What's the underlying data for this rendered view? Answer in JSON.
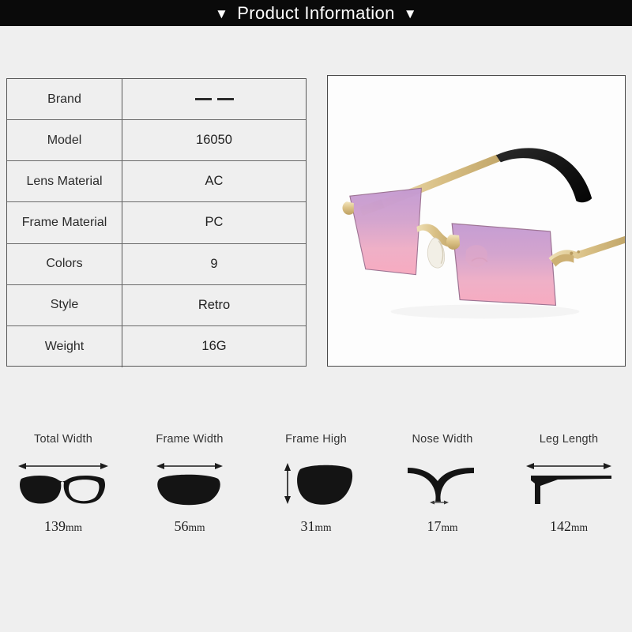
{
  "header": {
    "title": "Product Information",
    "left_marker": "▼",
    "right_marker": "▼",
    "background_color": "#0a0a0a",
    "text_color": "#ffffff"
  },
  "spec_table": {
    "rows": [
      {
        "label": "Brand",
        "value": "— —",
        "is_dash": true
      },
      {
        "label": "Model",
        "value": "16050",
        "is_dash": false
      },
      {
        "label": "Lens Material",
        "value": "AC",
        "is_dash": false
      },
      {
        "label": "Frame Material",
        "value": "PC",
        "is_dash": false
      },
      {
        "label": "Colors",
        "value": "9",
        "is_dash": false
      },
      {
        "label": "Style",
        "value": "Retro",
        "is_dash": false
      },
      {
        "label": "Weight",
        "value": "16G",
        "is_dash": false
      }
    ]
  },
  "product_image": {
    "alt": "Rimless rectangular sunglasses with gold metal temples, black temple tips and purple-to-pink gradient lenses",
    "lens_gradient_top": "#c9a0d6",
    "lens_gradient_bottom": "#f5a7c3",
    "metal_color": "#e8d49a",
    "temple_tip_color": "#141414",
    "background_color": "#fdfdfd"
  },
  "measurements": [
    {
      "label": "Total Width",
      "number": "139",
      "unit": "mm",
      "icon": "full-frame-width-icon"
    },
    {
      "label": "Frame Width",
      "number": "56",
      "unit": "mm",
      "icon": "single-lens-width-icon"
    },
    {
      "label": "Frame High",
      "number": "31",
      "unit": "mm",
      "icon": "single-lens-height-icon"
    },
    {
      "label": "Nose Width",
      "number": "17",
      "unit": "mm",
      "icon": "nose-bridge-icon"
    },
    {
      "label": "Leg Length",
      "number": "142",
      "unit": "mm",
      "icon": "temple-arm-icon"
    }
  ],
  "page": {
    "background_color": "#efefef"
  }
}
